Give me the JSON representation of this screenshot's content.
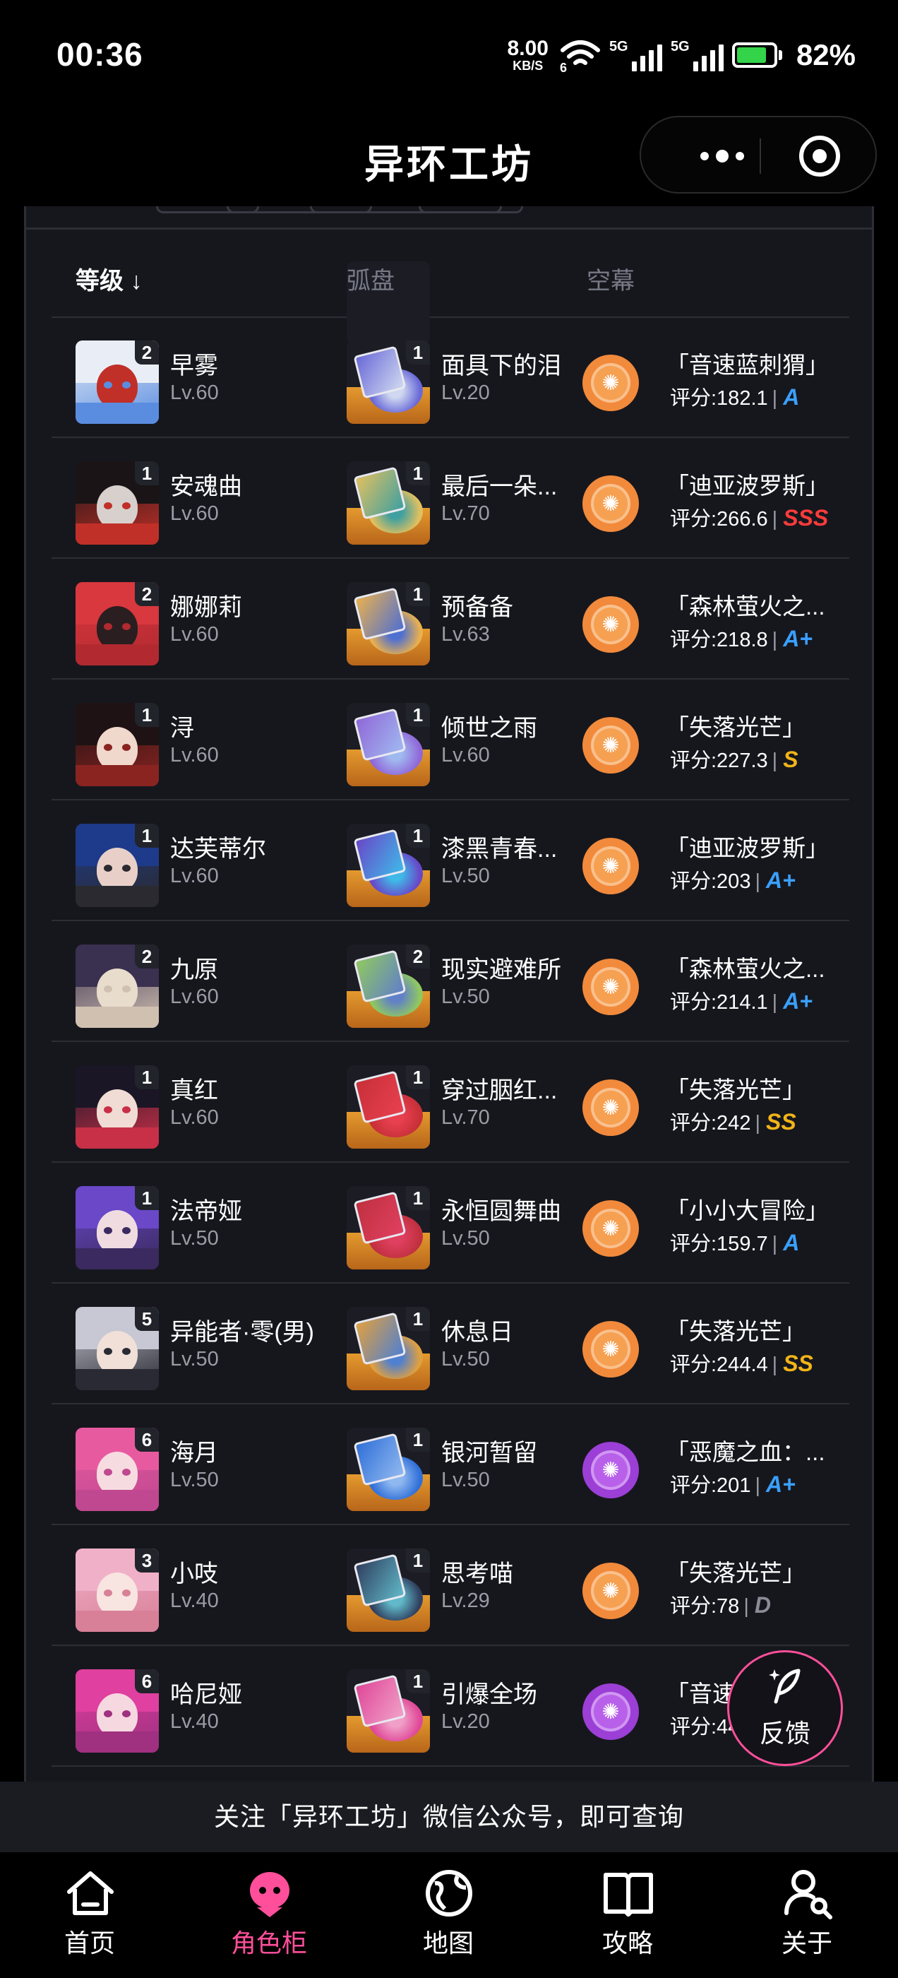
{
  "status_bar": {
    "time": "00:36",
    "net_speed": "8.00",
    "net_unit": "KB/S",
    "wifi_sub": "6",
    "signal1": "5G",
    "signal2": "5G",
    "battery": "82%",
    "battery_level": 0.82
  },
  "title_bar": {
    "title": "异环工坊"
  },
  "table": {
    "headers": {
      "level": "等级 ↓",
      "disk": "弧盘",
      "screen": "空幕"
    },
    "rows": [
      {
        "badge": "2",
        "name": "早雾",
        "lv": "Lv.60",
        "disk_badge": "1",
        "disk_name": "面具下的泪",
        "disk_lv": "Lv.20",
        "screen_name": "「音速蓝刺猬」",
        "score": "评分:182.1",
        "grade": "A",
        "grade_color": "#3aa0ff",
        "medal": "orange",
        "avatar": [
          "#e9eef6",
          "#c03028",
          "#5a8de0"
        ],
        "disk_color": [
          "#6a6ad8",
          "#cfd8f0"
        ]
      },
      {
        "badge": "1",
        "name": "安魂曲",
        "lv": "Lv.60",
        "disk_badge": "1",
        "disk_name": "最后一朵...",
        "disk_lv": "Lv.70",
        "screen_name": "「迪亚波罗斯」",
        "score": "评分:266.6",
        "grade": "SSS",
        "grade_color": "#ff3b3b",
        "medal": "orange",
        "avatar": [
          "#1a1416",
          "#d8d0cc",
          "#c03028"
        ],
        "disk_color": [
          "#e0c060",
          "#40a0a0"
        ]
      },
      {
        "badge": "2",
        "name": "娜娜莉",
        "lv": "Lv.60",
        "disk_badge": "1",
        "disk_name": "预备备",
        "disk_lv": "Lv.63",
        "screen_name": "「森林萤火之...",
        "score": "评分:218.8",
        "grade": "A+",
        "grade_color": "#3aa0ff",
        "medal": "orange",
        "avatar": [
          "#d8383e",
          "#2a1e20",
          "#b22a30"
        ],
        "disk_color": [
          "#e8b050",
          "#5070d0"
        ]
      },
      {
        "badge": "1",
        "name": "浔",
        "lv": "Lv.60",
        "disk_badge": "1",
        "disk_name": "倾世之雨",
        "disk_lv": "Lv.60",
        "screen_name": "「失落光芒」",
        "score": "评分:227.3",
        "grade": "S",
        "grade_color": "#f2b418",
        "medal": "orange",
        "avatar": [
          "#1e1214",
          "#f0d8cc",
          "#8a2420"
        ],
        "disk_color": [
          "#9068d8",
          "#a0b8f0"
        ]
      },
      {
        "badge": "1",
        "name": "达芙蒂尔",
        "lv": "Lv.60",
        "disk_badge": "1",
        "disk_name": "漆黑青春...",
        "disk_lv": "Lv.50",
        "screen_name": "「迪亚波罗斯」",
        "score": "评分:203",
        "grade": "A+",
        "grade_color": "#3aa0ff",
        "medal": "orange",
        "avatar": [
          "#1e3a8a",
          "#e8d0c8",
          "#2a2a30"
        ],
        "disk_color": [
          "#6848c8",
          "#40b8e8"
        ]
      },
      {
        "badge": "2",
        "name": "九原",
        "lv": "Lv.60",
        "disk_badge": "2",
        "disk_name": "现实避难所",
        "disk_lv": "Lv.50",
        "screen_name": "「森林萤火之...",
        "score": "评分:214.1",
        "grade": "A+",
        "grade_color": "#3aa0ff",
        "medal": "orange",
        "avatar": [
          "#3a3050",
          "#e8dccc",
          "#d0c0b0"
        ],
        "disk_color": [
          "#90c860",
          "#6080c8"
        ]
      },
      {
        "badge": "1",
        "name": "真红",
        "lv": "Lv.60",
        "disk_badge": "1",
        "disk_name": "穿过胭红...",
        "disk_lv": "Lv.70",
        "screen_name": "「失落光芒」",
        "score": "评分:242",
        "grade": "SS",
        "grade_color": "#f2b418",
        "medal": "orange",
        "avatar": [
          "#1a1626",
          "#f0dcd4",
          "#c83048"
        ],
        "disk_color": [
          "#c83038",
          "#e84050"
        ]
      },
      {
        "badge": "1",
        "name": "法帝娅",
        "lv": "Lv.50",
        "disk_badge": "1",
        "disk_name": "永恒圆舞曲",
        "disk_lv": "Lv.50",
        "screen_name": "「小小大冒险」",
        "score": "评分:159.7",
        "grade": "A",
        "grade_color": "#3aa0ff",
        "medal": "orange",
        "avatar": [
          "#6a48c8",
          "#f0dce0",
          "#3a2a60"
        ],
        "disk_color": [
          "#c03040",
          "#e04060"
        ]
      },
      {
        "badge": "5",
        "name": "异能者·零(男)",
        "lv": "Lv.50",
        "disk_badge": "1",
        "disk_name": "休息日",
        "disk_lv": "Lv.50",
        "screen_name": "「失落光芒」",
        "score": "评分:244.4",
        "grade": "SS",
        "grade_color": "#f2b418",
        "medal": "orange",
        "avatar": [
          "#c8c8d4",
          "#f0e0d8",
          "#2a2a34"
        ],
        "disk_color": [
          "#e0a040",
          "#5080d0"
        ]
      },
      {
        "badge": "6",
        "name": "海月",
        "lv": "Lv.50",
        "disk_badge": "1",
        "disk_name": "银河暂留",
        "disk_lv": "Lv.50",
        "screen_name": "「恶魔之血：...",
        "score": "评分:201",
        "grade": "A+",
        "grade_color": "#3aa0ff",
        "medal": "purple",
        "avatar": [
          "#e85aa0",
          "#f6dce0",
          "#c04890"
        ],
        "disk_color": [
          "#3070d8",
          "#90b8f0"
        ]
      },
      {
        "badge": "3",
        "name": "小吱",
        "lv": "Lv.40",
        "disk_badge": "1",
        "disk_name": "思考喵",
        "disk_lv": "Lv.29",
        "screen_name": "「失落光芒」",
        "score": "评分:78",
        "grade": "D",
        "grade_color": "#8a8c96",
        "medal": "orange",
        "avatar": [
          "#f0b0c8",
          "#f8e4e0",
          "#d88098"
        ],
        "disk_color": [
          "#304060",
          "#60b8c8"
        ]
      },
      {
        "badge": "6",
        "name": "哈尼娅",
        "lv": "Lv.40",
        "disk_badge": "1",
        "disk_name": "引爆全场",
        "disk_lv": "Lv.20",
        "screen_name": "「音速蓝",
        "score": "评分:44",
        "grade": "",
        "grade_color": "#3aa0ff",
        "medal": "purple",
        "avatar": [
          "#e040a0",
          "#f6d8e0",
          "#a03080"
        ],
        "disk_color": [
          "#e04898",
          "#f0a0c8"
        ]
      }
    ]
  },
  "feedback": {
    "label": "反馈"
  },
  "notice": {
    "text": "关注「异环工坊」微信公众号，即可查询"
  },
  "tabs": [
    {
      "label": "首页",
      "icon": "home-icon",
      "active": false
    },
    {
      "label": "角色柜",
      "icon": "character-icon",
      "active": true
    },
    {
      "label": "地图",
      "icon": "globe-icon",
      "active": false
    },
    {
      "label": "攻略",
      "icon": "book-icon",
      "active": false
    },
    {
      "label": "关于",
      "icon": "user-search-icon",
      "active": false
    }
  ],
  "colors": {
    "accent": "#ff4f9a",
    "card_bg": "#16171d",
    "medal_orange": "#f28a3c",
    "medal_purple": "#9b3fd6"
  }
}
